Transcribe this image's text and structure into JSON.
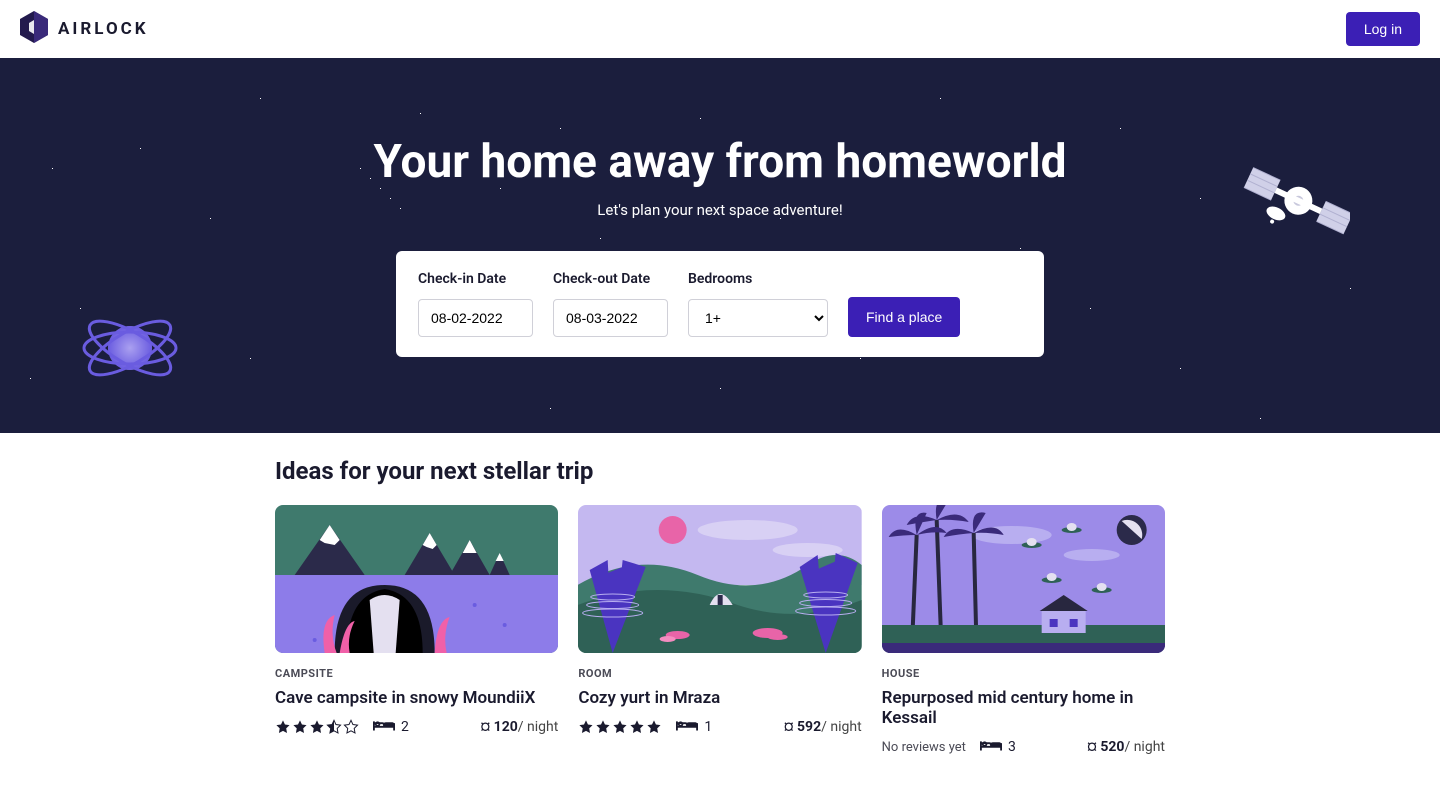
{
  "brand": {
    "name": "AIRLOCK"
  },
  "header": {
    "login_label": "Log in"
  },
  "hero": {
    "headline": "Your home away from homeworld",
    "subline": "Let's plan your next space adventure!"
  },
  "search": {
    "checkin": {
      "label": "Check-in Date",
      "value": "08-02-2022"
    },
    "checkout": {
      "label": "Check-out Date",
      "value": "08-03-2022"
    },
    "bedrooms": {
      "label": "Bedrooms",
      "value": "1+",
      "options": [
        "1+"
      ]
    },
    "submit_label": "Find a place"
  },
  "listings": {
    "title": "Ideas for your next stellar trip",
    "currency": "¤",
    "cards": [
      {
        "tag": "CAMPSITE",
        "title": "Cave campsite in snowy MoundiiX",
        "rating": 3.5,
        "beds": 2,
        "price": 120,
        "price_unit": "/ night"
      },
      {
        "tag": "ROOM",
        "title": "Cozy yurt in Mraza",
        "rating": 5,
        "beds": 1,
        "price": 592,
        "price_unit": "/ night"
      },
      {
        "tag": "HOUSE",
        "title": "Repurposed mid century home in Kessail",
        "no_reviews": "No reviews yet",
        "beds": 3,
        "price": 520,
        "price_unit": "/ night"
      }
    ]
  }
}
